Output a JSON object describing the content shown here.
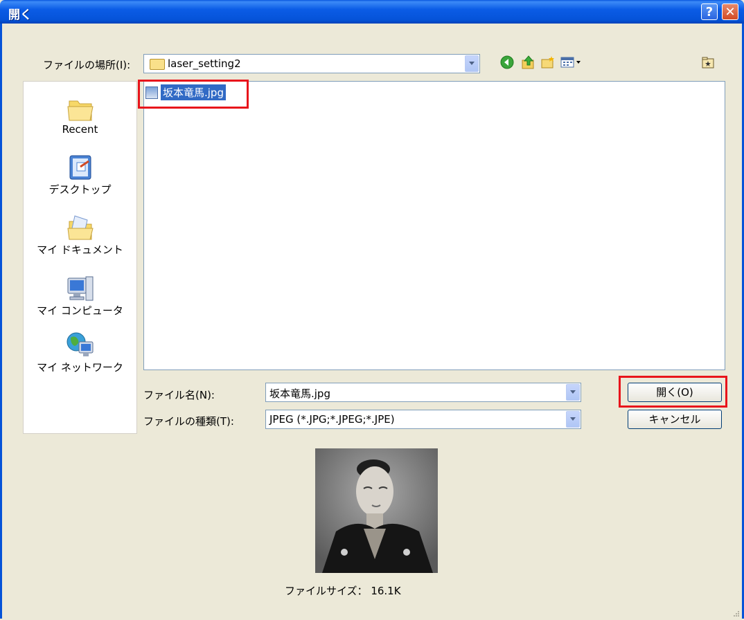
{
  "window": {
    "title": "開く"
  },
  "look_in": {
    "label": "ファイルの場所(I):",
    "value": "laser_setting2"
  },
  "places": [
    {
      "label": "Recent",
      "icon": "recent-folder-icon"
    },
    {
      "label": "デスクトップ",
      "icon": "desktop-icon"
    },
    {
      "label": "マイ ドキュメント",
      "icon": "my-documents-icon"
    },
    {
      "label": "マイ コンピュータ",
      "icon": "my-computer-icon"
    },
    {
      "label": "マイ ネットワーク",
      "icon": "my-network-icon"
    }
  ],
  "files": [
    {
      "name": "坂本竜馬.jpg",
      "selected": true
    }
  ],
  "filename": {
    "label": "ファイル名(N):",
    "value": "坂本竜馬.jpg"
  },
  "filetype": {
    "label": "ファイルの種類(T):",
    "value": "JPEG (*.JPG;*.JPEG;*.JPE)"
  },
  "buttons": {
    "open": "開く(O)",
    "cancel": "キャンセル"
  },
  "preview": {
    "caption": "ファイルサイズ： 16.1K"
  },
  "colors": {
    "titlebar": "#0553d8",
    "selection": "#316ac5",
    "highlight_box": "#e8141b",
    "dialog_bg": "#ece9d8"
  }
}
